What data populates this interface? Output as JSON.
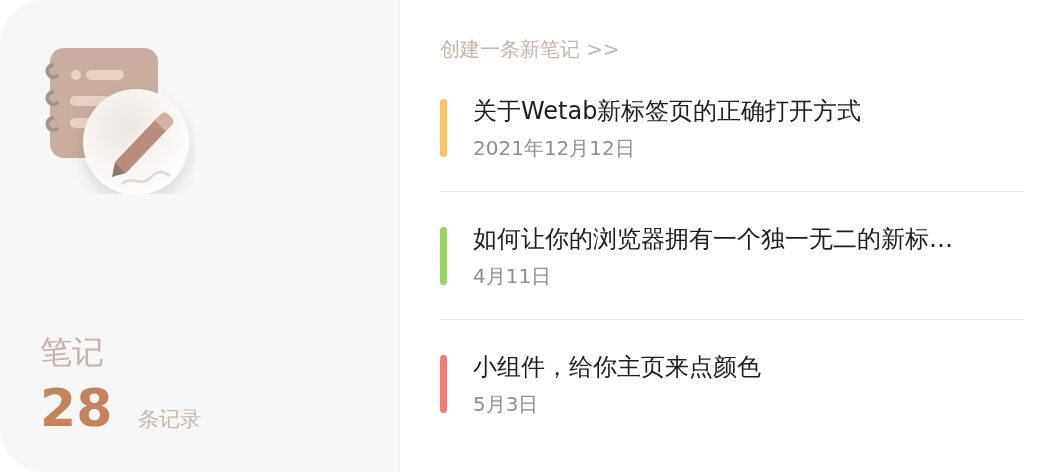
{
  "summary": {
    "title": "笔记",
    "count": "28",
    "count_unit": "条记录"
  },
  "create_link": "创建一条新笔记 >>",
  "notes": [
    {
      "title": "关于Wetab新标签页的正确打开方式",
      "date": "2021年12月12日",
      "color": "#f9c563"
    },
    {
      "title": "如何让你的浏览器拥有一个独一无二的新标…",
      "date": "4月11日",
      "color": "#98d45e"
    },
    {
      "title": "小组件，给你主页来点颜色",
      "date": "5月3日",
      "color": "#f47a74"
    }
  ]
}
